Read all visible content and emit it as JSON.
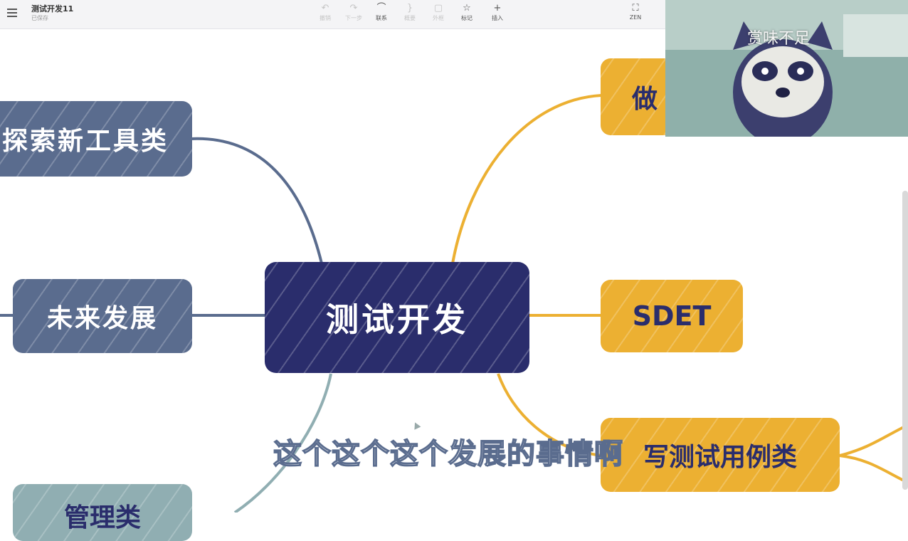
{
  "toolbar": {
    "title": "测试开发11",
    "status": "已保存",
    "items": [
      {
        "label": "撤销",
        "glyph": "↶",
        "enabled": false
      },
      {
        "label": "下一步",
        "glyph": "↷",
        "enabled": false
      },
      {
        "label": "联系",
        "glyph": "⌒",
        "enabled": true
      },
      {
        "label": "概要",
        "glyph": "}",
        "enabled": false
      },
      {
        "label": "外框",
        "glyph": "▢",
        "enabled": false
      },
      {
        "label": "标记",
        "glyph": "☆",
        "enabled": true
      },
      {
        "label": "插入",
        "glyph": "+",
        "enabled": true
      },
      {
        "label": "ZEN",
        "glyph": "⛶",
        "enabled": true
      }
    ]
  },
  "mindmap": {
    "root": "测试开发",
    "left_nodes": [
      "探索新工具类",
      "未来发展",
      "管理类"
    ],
    "right_nodes": [
      "做",
      "SDET",
      "写测试用例类"
    ],
    "colors": {
      "root": "#2a2d6c",
      "left_branch": "#5a6c8e",
      "right_branch": "#ecb032",
      "lower_left_branch": "#90aeb2"
    }
  },
  "video_overlay": {
    "watermark": "赏味不足"
  },
  "subtitle": "这个这个这个发展的事情啊"
}
